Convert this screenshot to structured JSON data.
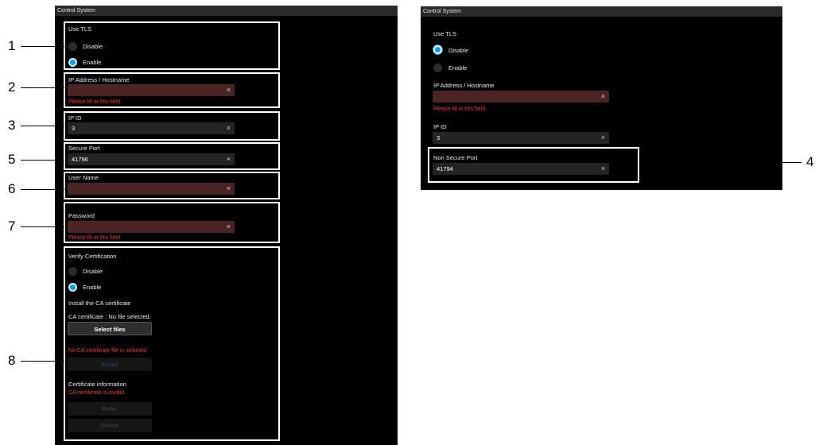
{
  "left": {
    "title": "Control System",
    "use_tls": {
      "label": "Use TLS",
      "options": [
        "Disable",
        "Enable"
      ],
      "selected": "Enable"
    },
    "ip_address": {
      "label": "IP Address / Hostname",
      "value": "",
      "error": "Please fill in this field."
    },
    "ip_id": {
      "label": "IP ID",
      "value": "3"
    },
    "secure_port": {
      "label": "Secure Port",
      "value": "41796"
    },
    "user_name": {
      "label": "User Name",
      "value": ""
    },
    "password": {
      "label": "Password",
      "value": "",
      "error": "Please fill in this field."
    },
    "verify_cert": {
      "label": "Verify Certification",
      "options": [
        "Disable",
        "Enable"
      ],
      "selected": "Enable"
    },
    "install_ca": {
      "heading": "Install the CA certificate",
      "status": "CA certificate : No file selected.",
      "select_label": "Select files",
      "error": "No CA certificate file is selected.",
      "install_label": "Install"
    },
    "cert_info": {
      "heading": "Certificate information",
      "error": "CA certificate is invalid.",
      "refer_label": "Refer",
      "delete_label": "Delete"
    }
  },
  "right": {
    "title": "Control System",
    "use_tls": {
      "label": "Use TLS",
      "options": [
        "Disable",
        "Enable"
      ],
      "selected": "Disable"
    },
    "ip_address": {
      "label": "IP Address / Hostname",
      "value": "",
      "error": "Please fill in this field."
    },
    "ip_id": {
      "label": "IP ID",
      "value": "3"
    },
    "non_secure_port": {
      "label": "Non Secure Port",
      "value": "41794"
    }
  },
  "callouts": [
    "1",
    "2",
    "3",
    "4",
    "5",
    "6",
    "7",
    "8"
  ],
  "clear_glyph": "×",
  "colors": {
    "error": "#ff3030",
    "accent": "#00a0ff",
    "panel": "#000000",
    "invalid_field": "#4a2523"
  }
}
